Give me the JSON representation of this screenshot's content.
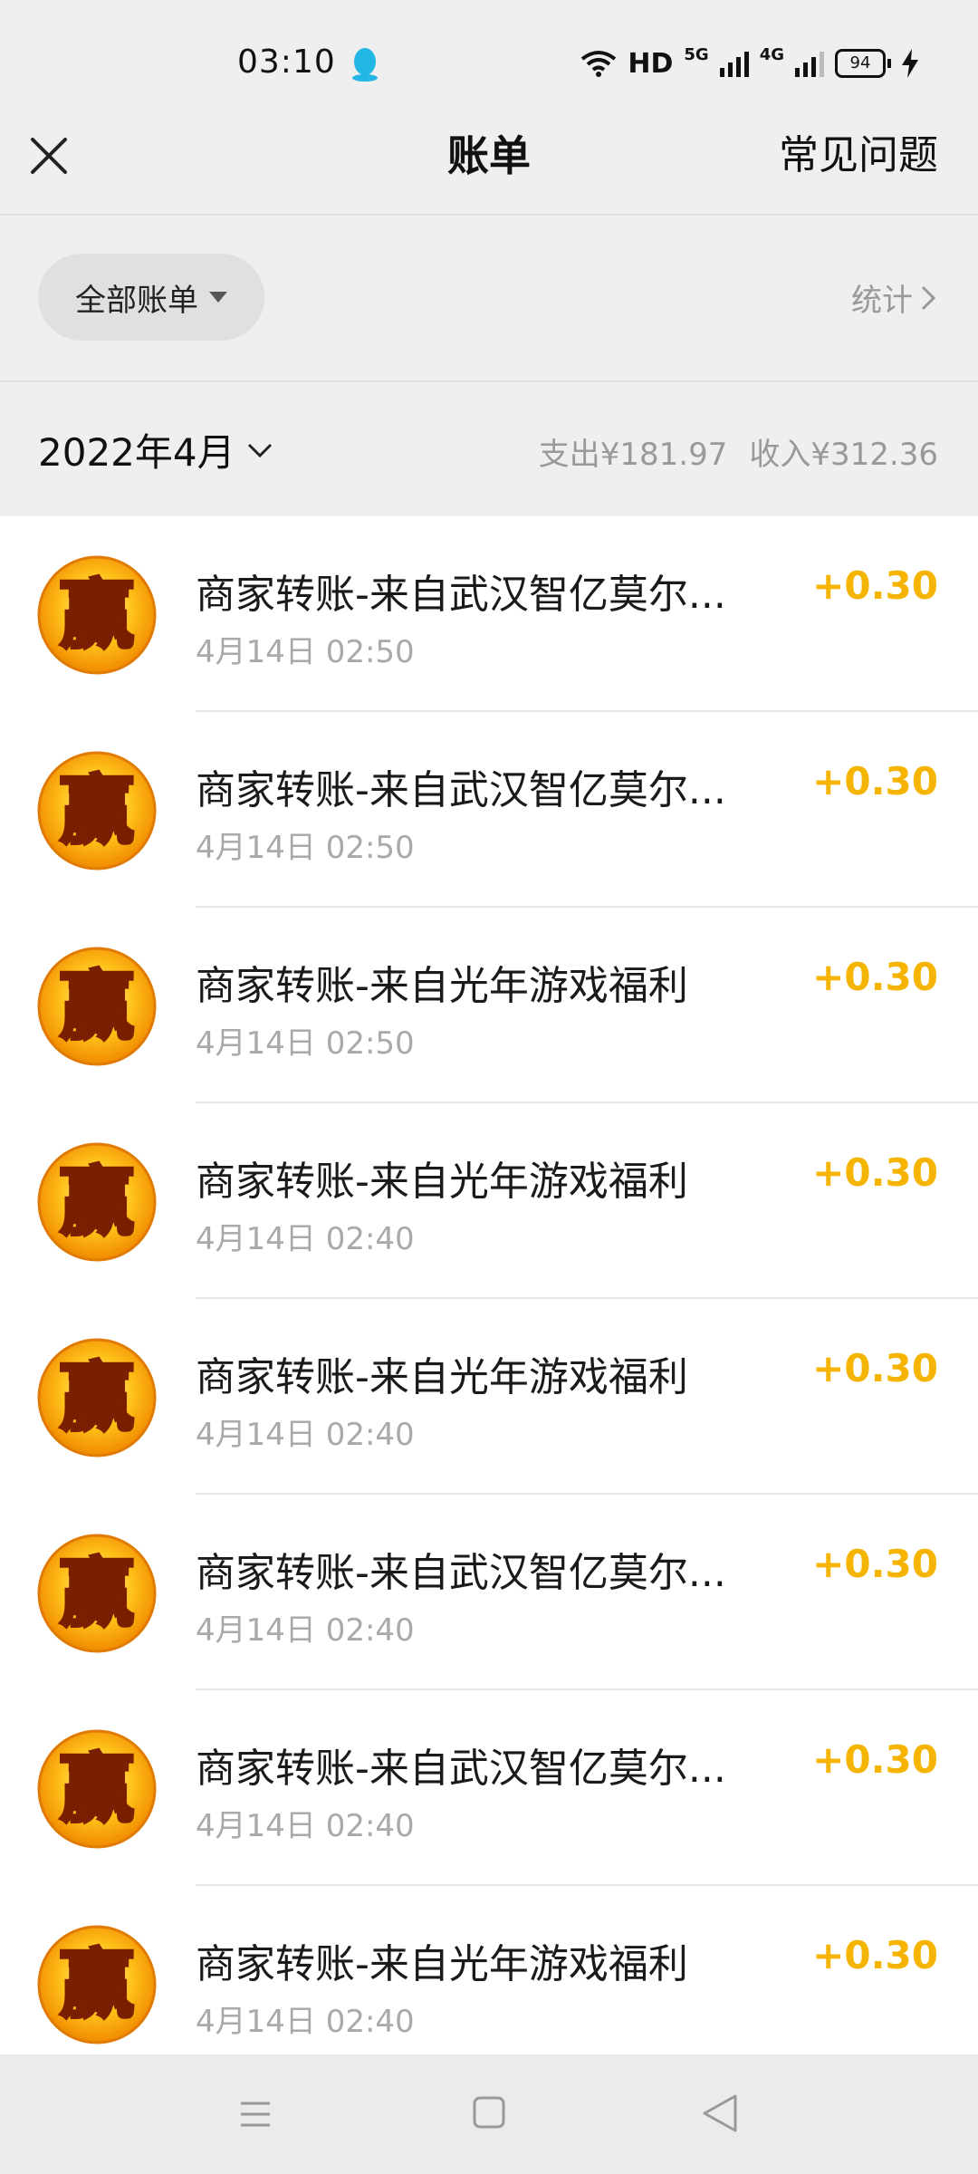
{
  "status_bar": {
    "time": "03:10",
    "network_label": "HD",
    "net5g": "5G",
    "net4g": "4G",
    "battery": "94"
  },
  "header": {
    "title": "账单",
    "faq": "常见问题"
  },
  "filter": {
    "all_bills": "全部账单",
    "stats": "统计"
  },
  "month": {
    "label": "2022年4月",
    "expense": "支出¥181.97",
    "income": "收入¥312.36"
  },
  "transactions": [
    {
      "title": "商家转账-来自武汉智亿莫尔...",
      "time": "4月14日 02:50",
      "amount": "+0.30"
    },
    {
      "title": "商家转账-来自武汉智亿莫尔...",
      "time": "4月14日 02:50",
      "amount": "+0.30"
    },
    {
      "title": "商家转账-来自光年游戏福利",
      "time": "4月14日 02:50",
      "amount": "+0.30"
    },
    {
      "title": "商家转账-来自光年游戏福利",
      "time": "4月14日 02:40",
      "amount": "+0.30"
    },
    {
      "title": "商家转账-来自光年游戏福利",
      "time": "4月14日 02:40",
      "amount": "+0.30"
    },
    {
      "title": "商家转账-来自武汉智亿莫尔...",
      "time": "4月14日 02:40",
      "amount": "+0.30"
    },
    {
      "title": "商家转账-来自武汉智亿莫尔...",
      "time": "4月14日 02:40",
      "amount": "+0.30"
    },
    {
      "title": "商家转账-来自光年游戏福利",
      "time": "4月14日 02:40",
      "amount": "+0.30"
    }
  ],
  "avatar_glyph": "赢",
  "colors": {
    "income_amount": "#f4b400",
    "secondary_text": "#a9a9a9",
    "header_bg": "#efefef"
  }
}
